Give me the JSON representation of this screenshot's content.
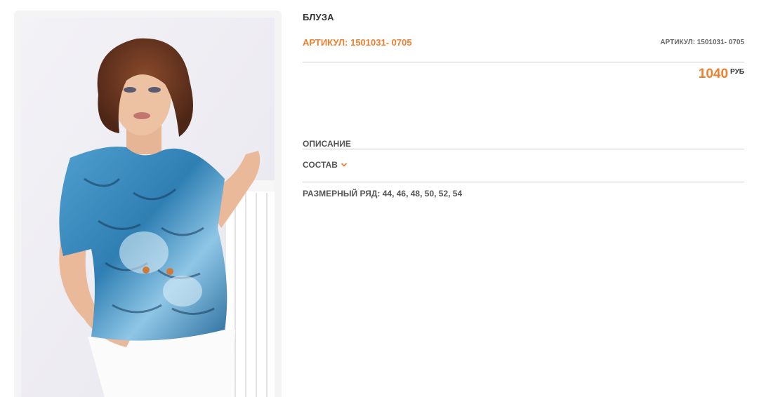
{
  "product": {
    "title": "БЛУЗА",
    "sku_main": "АРТИКУЛ: 1501031- 0705",
    "sku_right": "АРТИКУЛ: 1501031- 0705",
    "price_value": "1040",
    "price_currency": "РУБ",
    "description_label": "ОПИСАНИЕ",
    "composition_label": "СОСТАВ",
    "sizes_label": "РАЗМЕРНЫЙ РЯД: 44, 46, 48, 50, 52, 54"
  },
  "icons": {
    "composition_toggle": "chevron-down-icon"
  },
  "colors": {
    "accent": "#ef7f2f",
    "text": "#333333",
    "muted": "#555555",
    "rule": "#cfcfcf"
  }
}
